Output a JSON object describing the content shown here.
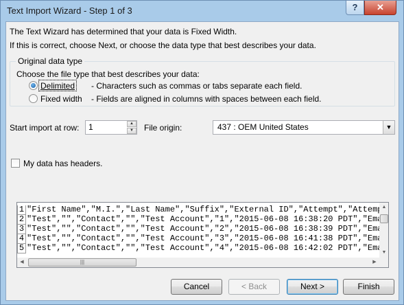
{
  "window": {
    "title": "Text Import Wizard - Step 1 of 3",
    "help_label": "?",
    "close_label": "✕"
  },
  "intro": {
    "line1": "The Text Wizard has determined that your data is Fixed Width.",
    "line2": "If this is correct, choose Next, or choose the data type that best describes your data."
  },
  "data_type": {
    "group_label": "Original data type",
    "prompt": "Choose the file type that best describes your data:",
    "options": [
      {
        "label": "Delimited",
        "description": "- Characters such as commas or tabs separate each field.",
        "selected": true
      },
      {
        "label": "Fixed width",
        "description": "- Fields are aligned in columns with spaces between each field.",
        "selected": false
      }
    ]
  },
  "start_row": {
    "label": "Start import at row:",
    "value": "1"
  },
  "file_origin": {
    "label": "File origin:",
    "value": "437 : OEM United States"
  },
  "headers_checkbox": {
    "label": "My data has headers.",
    "checked": false
  },
  "preview": {
    "lines": [
      {
        "num": "1",
        "text": "\"First Name\",\"M.I.\",\"Last Name\",\"Suffix\",\"External ID\",\"Attempt\",\"Attempt"
      },
      {
        "num": "2",
        "text": "\"Test\",\"\",\"Contact\",\"\",\"Test Account\",\"1\",\"2015-06-08 16:38:20 PDT\",\"Emai"
      },
      {
        "num": "3",
        "text": "\"Test\",\"\",\"Contact\",\"\",\"Test Account\",\"2\",\"2015-06-08 16:38:39 PDT\",\"Emai"
      },
      {
        "num": "4",
        "text": "\"Test\",\"\",\"Contact\",\"\",\"Test Account\",\"3\",\"2015-06-08 16:41:38 PDT\",\"Emai"
      },
      {
        "num": "5",
        "text": "\"Test\",\"\",\"Contact\",\"\",\"Test Account\",\"4\",\"2015-06-08 16:42:02 PDT\",\"Emai"
      }
    ]
  },
  "buttons": {
    "cancel": "Cancel",
    "back": "< Back",
    "next": "Next >",
    "finish": "Finish"
  }
}
